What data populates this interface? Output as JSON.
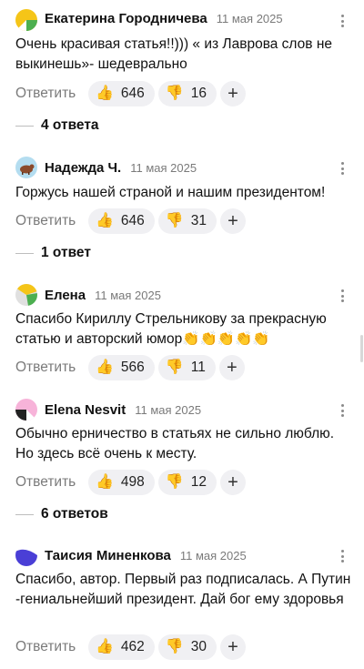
{
  "reply_label": "Ответить",
  "comments": [
    {
      "author": "Екатерина Городничева",
      "date": "11 мая 2025",
      "text": "Очень красивая статья!!))) « из Лаврова слов не выкинешь»- шедеврально",
      "likes": "646",
      "dislikes": "16",
      "replies": "4 ответа",
      "avatar_colors": [
        "#f5c518",
        "#4caf50",
        "#ffffff"
      ]
    },
    {
      "author": "Надежда Ч.",
      "date": "11 мая 2025",
      "text": "Горжусь нашей страной и нашим президентом!",
      "likes": "646",
      "dislikes": "31",
      "replies": "1 ответ",
      "avatar_colors": [
        "#b4ddf0",
        "#8b4a2b"
      ]
    },
    {
      "author": "Елена",
      "date": "11 мая 2025",
      "text": "Спасибо Кириллу Стрельникову за прекрасную статью и авторский юмор👏👏👏👏👏",
      "likes": "566",
      "dislikes": "11",
      "replies": "",
      "avatar_colors": [
        "#f5c518",
        "#4caf50",
        "#e0e0e0"
      ]
    },
    {
      "author": "Elena Nesvit",
      "date": "11 мая 2025",
      "text": "Обычно ерничество в статьях не сильно люблю. Но здесь всё очень к месту.",
      "likes": "498",
      "dislikes": "12",
      "replies": "6 ответов",
      "avatar_colors": [
        "#f7b3d9",
        "#222222",
        "#ffffff"
      ]
    },
    {
      "author": "Таисия Миненкова",
      "date": "11 мая 2025",
      "text": "Спасибо, автор. Первый раз подписалась. А Путин -гениальнейший президент. Дай бог ему здоровья",
      "likes": "462",
      "dislikes": "30",
      "replies": "",
      "avatar_colors": [
        "#4a3fd6",
        "#ffffff"
      ]
    }
  ],
  "icons": {
    "like": "thumbs-up-icon",
    "dislike": "thumbs-down-icon",
    "add_reaction": "plus-icon",
    "more": "kebab-menu-icon"
  }
}
